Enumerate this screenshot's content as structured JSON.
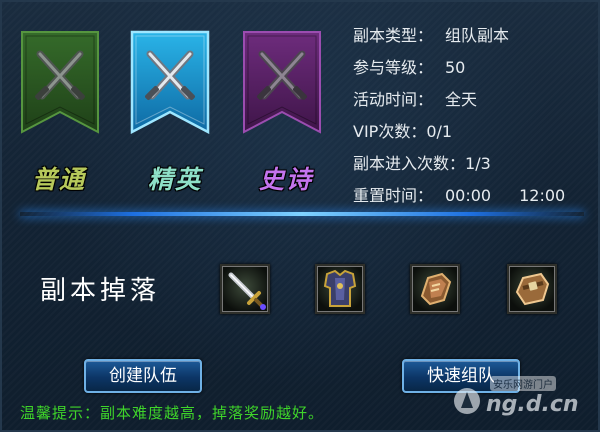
{
  "difficulties": [
    {
      "label": "普通",
      "color": "#3f7a2f"
    },
    {
      "label": "精英",
      "color": "#1e95c9"
    },
    {
      "label": "史诗",
      "color": "#7a2f8a"
    }
  ],
  "info": {
    "dungeon_type_label": "副本类型：",
    "dungeon_type_value": "组队副本",
    "level_label": "参与等级：",
    "level_value": "50",
    "active_time_label": "活动时间：",
    "active_time_value": "全天",
    "vip_label": "VIP次数：",
    "vip_value": "0/1",
    "entries_label": "副本进入次数：",
    "entries_value": "1/3",
    "reset_label": "重置时间：",
    "reset_time_1": "00:00",
    "reset_time_2": "12:00"
  },
  "drops": {
    "title": "副本掉落",
    "items": [
      {
        "icon": "sword-icon"
      },
      {
        "icon": "armor-icon"
      },
      {
        "icon": "gauntlet-icon"
      },
      {
        "icon": "belt-icon"
      }
    ]
  },
  "buttons": {
    "create_team": "创建队伍",
    "quick_team": "快速组队"
  },
  "tip": "温馨提示：副本难度越高，掉落奖励越好。",
  "watermark": {
    "line1": "安乐网游门户",
    "line2": "ng.d.cn"
  }
}
